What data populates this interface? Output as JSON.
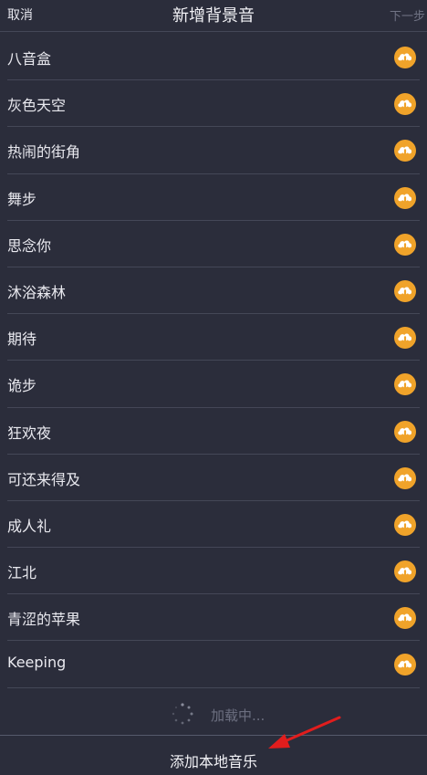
{
  "header": {
    "cancel_label": "取消",
    "title": "新增背景音",
    "next_label": "下一步"
  },
  "tracks": [
    {
      "name": "八音盒"
    },
    {
      "name": "灰色天空"
    },
    {
      "name": "热闹的街角"
    },
    {
      "name": "舞步"
    },
    {
      "name": "思念你"
    },
    {
      "name": "沐浴森林"
    },
    {
      "name": "期待"
    },
    {
      "name": "诡步"
    },
    {
      "name": "狂欢夜"
    },
    {
      "name": "可还来得及"
    },
    {
      "name": "成人礼"
    },
    {
      "name": "江北"
    },
    {
      "name": "青涩的苹果"
    },
    {
      "name": "Keeping"
    }
  ],
  "loading": {
    "text": "加载中..."
  },
  "footer": {
    "add_local_label": "添加本地音乐"
  },
  "icons": {
    "download": "download-cloud-icon",
    "spinner": "loading-spinner-icon",
    "annotation": "red-arrow-annotation"
  },
  "colors": {
    "background": "#2b2d3b",
    "accent": "#f0a32a",
    "divider": "#444757",
    "muted": "#707384",
    "annotation": "#e11d1d"
  }
}
